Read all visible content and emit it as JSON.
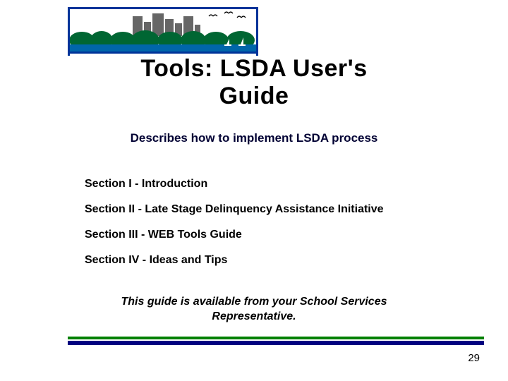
{
  "title_line1": "Tools: LSDA User's",
  "title_line2": "Guide",
  "subtitle": "Describes how to implement LSDA process",
  "sections": [
    "Section I - Introduction",
    "Section II - Late Stage Delinquency Assistance Initiative",
    "Section III - WEB Tools Guide",
    "Section IV - Ideas and Tips"
  ],
  "footer_line1": "This guide is available from your School Services",
  "footer_line2": "Representative.",
  "page_number": "29",
  "colors": {
    "navy": "#000080",
    "green": "#008000",
    "dark_text": "#000033"
  }
}
